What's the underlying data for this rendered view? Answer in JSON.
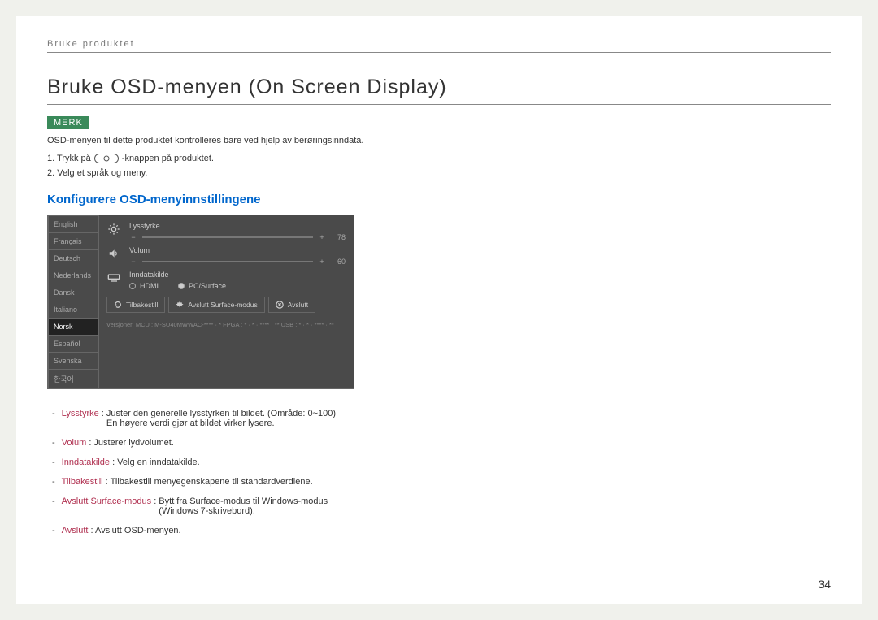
{
  "header": {
    "section": "Bruke produktet"
  },
  "title": "Bruke OSD-menyen (On Screen Display)",
  "note": {
    "tag": "MERK",
    "text": "OSD-menyen til dette produktet kontrolleres bare ved hjelp av berøringsinndata."
  },
  "steps": {
    "s1a": "1. Trykk på ",
    "s1b": "-knappen på produktet.",
    "s2": "2. Velg et språk og meny."
  },
  "subheading": "Konfigurere OSD-menyinnstillingene",
  "osd": {
    "languages": [
      "English",
      "Français",
      "Deutsch",
      "Nederlands",
      "Dansk",
      "Italiano",
      "Norsk",
      "Español",
      "Svenska",
      "한국어"
    ],
    "active_lang_index": 6,
    "brightness": {
      "label": "Lysstyrke",
      "value": "78"
    },
    "volume": {
      "label": "Volum",
      "value": "60"
    },
    "input": {
      "label": "Inndatakilde",
      "opt1": "HDMI",
      "opt2": "PC/Surface"
    },
    "buttons": {
      "reset": "Tilbakestill",
      "exit_surface": "Avslutt Surface-modus",
      "exit": "Avslutt"
    },
    "version": "Versjoner: MCU : M-SU40MWWAC-**** · *   FPGA : * · * · **** · **   USB : * · * · **** · **"
  },
  "descriptions": [
    {
      "term": "Lysstyrke",
      "text": ": Juster den generelle lysstyrken til bildet. (Område: 0~100)",
      "text2": "En høyere verdi gjør at bildet virker lysere."
    },
    {
      "term": "Volum",
      "text": ": Justerer lydvolumet."
    },
    {
      "term": "Inndatakilde",
      "text": ": Velg en inndatakilde."
    },
    {
      "term": "Tilbakestill",
      "text": ": Tilbakestill menyegenskapene til standardverdiene."
    },
    {
      "term": "Avslutt Surface-modus",
      "text": ": Bytt fra Surface-modus til Windows-modus",
      "text2": "(Windows 7-skrivebord)."
    },
    {
      "term": "Avslutt",
      "text": ": Avslutt OSD-menyen."
    }
  ],
  "page_number": "34"
}
